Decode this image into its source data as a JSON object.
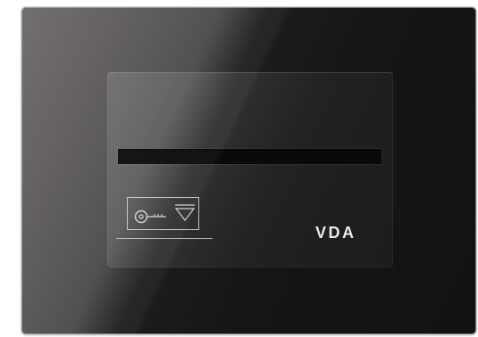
{
  "brand": {
    "text": "VDA"
  },
  "icons": {
    "key": "key-icon",
    "insert_arrow": "triangle-down-icon"
  },
  "colors": {
    "panel": "#121212",
    "brand_text": "#e9e9e9",
    "slot": "#0a0a0a"
  }
}
